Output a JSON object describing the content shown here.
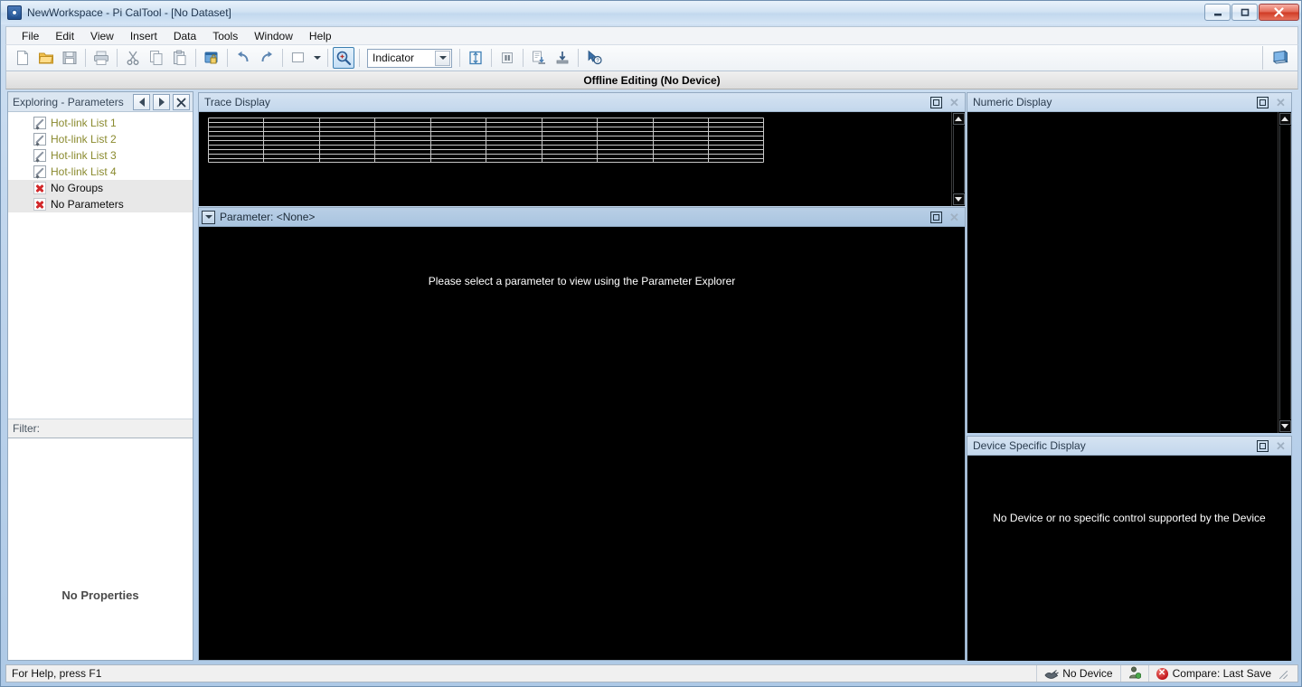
{
  "window": {
    "title": "NewWorkspace - Pi CalTool - [No Dataset]",
    "icon": "app-logo-icon",
    "minimize_label": "—",
    "maximize_label": "□",
    "close_label": "✕"
  },
  "menubar": {
    "items": [
      {
        "label": "File"
      },
      {
        "label": "Edit"
      },
      {
        "label": "View"
      },
      {
        "label": "Insert"
      },
      {
        "label": "Data"
      },
      {
        "label": "Tools"
      },
      {
        "label": "Window"
      },
      {
        "label": "Help"
      }
    ]
  },
  "toolbar": {
    "buttons": [
      {
        "name": "new-icon",
        "tip": "New"
      },
      {
        "name": "open-folder-icon",
        "tip": "Open"
      },
      {
        "name": "save-icon",
        "tip": "Save"
      },
      {
        "name": "print-icon",
        "tip": "Print"
      },
      {
        "name": "cut-icon",
        "tip": "Cut"
      },
      {
        "name": "copy-icon",
        "tip": "Copy"
      },
      {
        "name": "paste-icon",
        "tip": "Paste"
      },
      {
        "name": "secure-window-icon",
        "tip": "Lock"
      },
      {
        "name": "undo-icon",
        "tip": "Undo"
      },
      {
        "name": "redo-icon",
        "tip": "Redo"
      },
      {
        "name": "window-icon",
        "tip": "Window"
      },
      {
        "name": "zoom-search-icon",
        "tip": "Parameter Explorer"
      },
      {
        "name": "trace-fit-icon",
        "tip": "Fit Trace"
      },
      {
        "name": "pause-icon",
        "tip": "Pause"
      },
      {
        "name": "import-icon",
        "tip": "Import"
      },
      {
        "name": "export-icon",
        "tip": "Export"
      },
      {
        "name": "help-pointer-icon",
        "tip": "Context Help"
      }
    ],
    "combo": {
      "value": "Indicator",
      "options": [
        "Indicator"
      ]
    },
    "right_icon": "monitor-device-icon"
  },
  "banner": {
    "text": "Offline Editing (No Device)"
  },
  "explorer": {
    "title": "Exploring - Parameters",
    "nav": {
      "back": "◀",
      "forward": "▶",
      "close": "✕"
    },
    "items": [
      {
        "label": "Hot-link List 1",
        "icon": "hotlink-pencil-flag-icon",
        "style": "olive",
        "selected": false
      },
      {
        "label": "Hot-link List 2",
        "icon": "hotlink-pencil-icon",
        "style": "olive",
        "selected": false
      },
      {
        "label": "Hot-link List 3",
        "icon": "hotlink-pencil-icon",
        "style": "olive",
        "selected": false
      },
      {
        "label": "Hot-link List 4",
        "icon": "hotlink-pencil-icon",
        "style": "olive",
        "selected": false
      },
      {
        "label": "No Groups",
        "icon": "red-x-icon",
        "style": "black",
        "selected": true
      },
      {
        "label": "No Parameters",
        "icon": "red-x-icon",
        "style": "black",
        "selected": true
      }
    ],
    "filter_label": "Filter:",
    "filter_value": "",
    "properties_empty": "No Properties"
  },
  "trace_display": {
    "title": "Trace Display",
    "maximize": "restore-icon",
    "close": "✕",
    "grid": {
      "columns": 10,
      "rows": 10,
      "line_color": "#c8c8c8",
      "background": "#000000"
    }
  },
  "parameter_panel": {
    "title": "Parameter: <None>",
    "dropdown": "▼",
    "maximize": "restore-icon",
    "close": "✕",
    "message": "Please select a parameter to view using the Parameter Explorer"
  },
  "numeric_display": {
    "title": "Numeric Display",
    "maximize": "restore-icon",
    "close": "✕",
    "content": ""
  },
  "device_display": {
    "title": "Device Specific Display",
    "maximize": "restore-icon",
    "close": "✕",
    "message": "No Device or no specific control supported by the Device"
  },
  "statusbar": {
    "help_text": "For Help, press F1",
    "device_status": "No Device",
    "device_icon": "plug-disconnected-icon",
    "user_icon": "user-status-icon",
    "compare_status": "Compare: Last Save",
    "compare_icon": "red-error-icon"
  },
  "colors": {
    "accent": "#3c7fb1",
    "panel_header": "#c3d7ec",
    "param_header": "#a9c4df",
    "olive_text": "#8a8a2e",
    "error_red": "#c1161c",
    "black_canvas": "#000000"
  }
}
